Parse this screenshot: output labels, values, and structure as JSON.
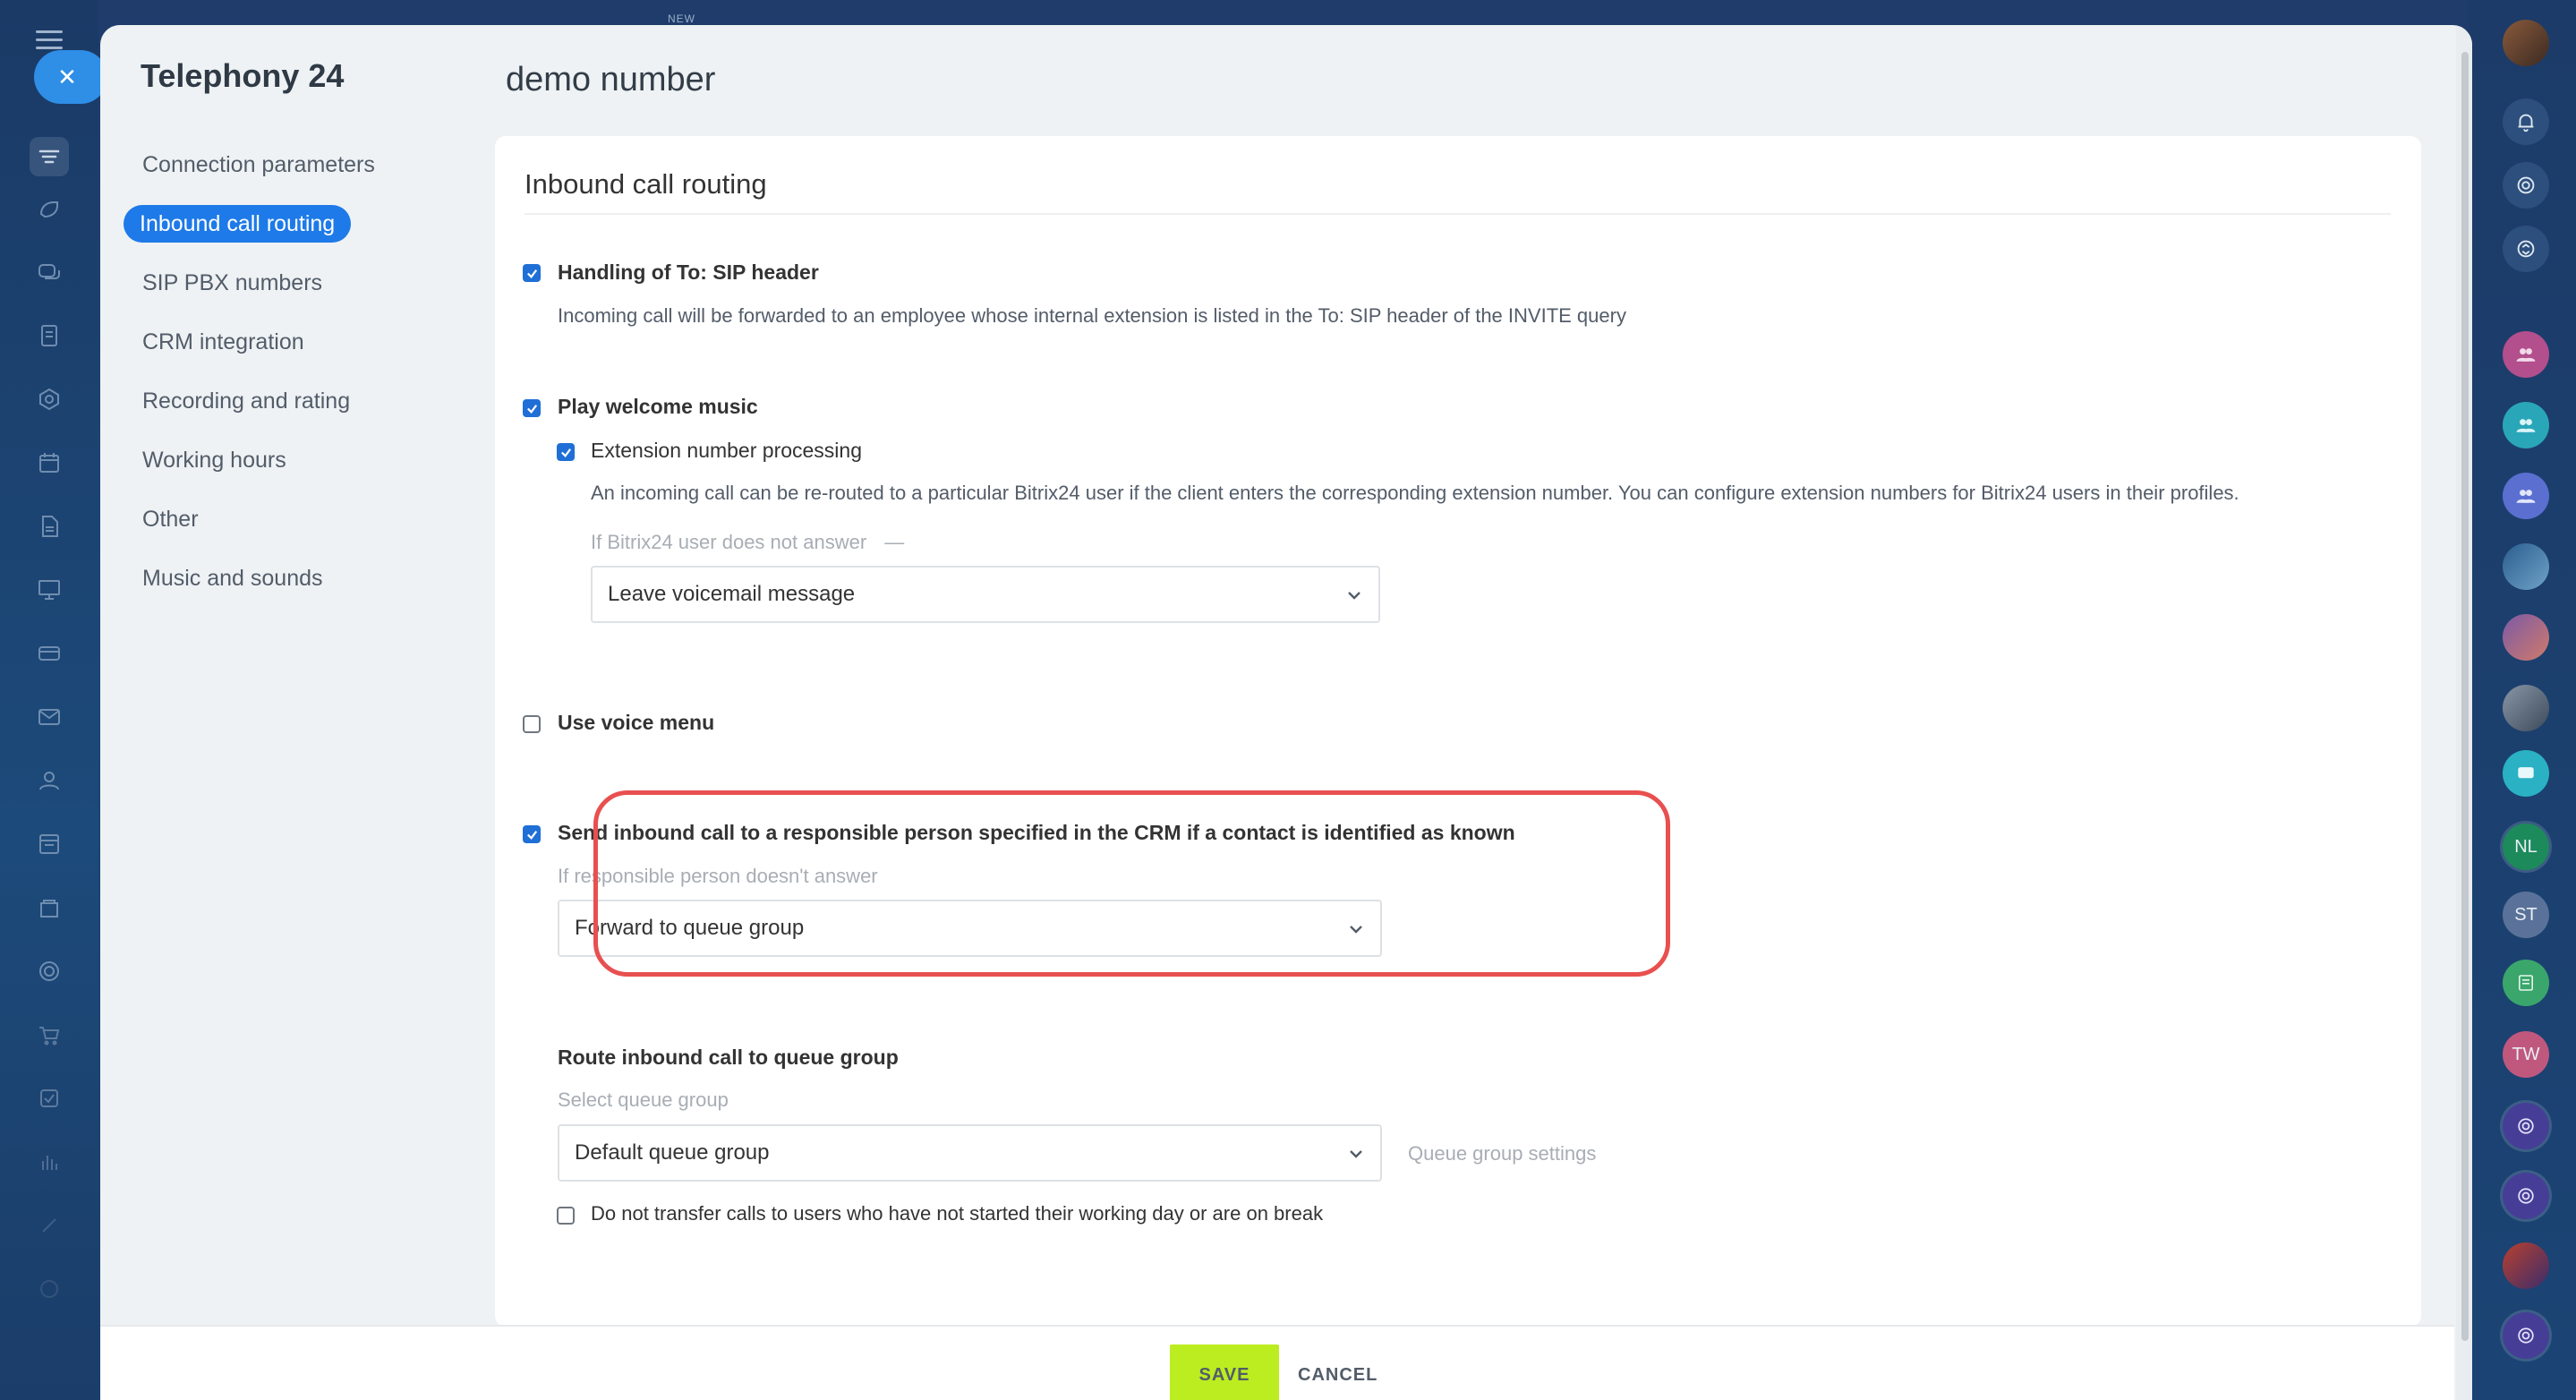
{
  "app": {
    "new_tag": "NEW"
  },
  "panel": {
    "title": "Telephony 24",
    "page_title": "demo number"
  },
  "menu": {
    "items": [
      {
        "label": "Connection parameters"
      },
      {
        "label": "Inbound call routing"
      },
      {
        "label": "SIP PBX numbers"
      },
      {
        "label": "CRM integration"
      },
      {
        "label": "Recording and rating"
      },
      {
        "label": "Working hours"
      },
      {
        "label": "Other"
      },
      {
        "label": "Music and sounds"
      }
    ],
    "active": "Inbound call routing"
  },
  "card": {
    "title": "Inbound call routing",
    "sip_header": {
      "label": "Handling of To: SIP header",
      "checked": true,
      "description": "Incoming call will be forwarded to an employee whose internal extension is listed in the To: SIP header of the INVITE query"
    },
    "welcome_music": {
      "label": "Play welcome music",
      "checked": true
    },
    "extension": {
      "label": "Extension number processing",
      "checked": true,
      "description": "An incoming call can be re-routed to a particular Bitrix24 user if the client enters the corresponding extension number. You can configure extension numbers for Bitrix24 users in their profiles.",
      "no_answer_hint": "If Bitrix24 user does not answer",
      "no_answer_dash": "—",
      "no_answer_value": "Leave voicemail message"
    },
    "voice_menu": {
      "label": "Use voice menu",
      "checked": false
    },
    "crm_responsible": {
      "label": "Send inbound call to a responsible person specified in the CRM if a contact is identified as known",
      "checked": true,
      "hint": "If responsible person doesn't answer",
      "value": "Forward to queue group"
    },
    "queue": {
      "heading": "Route inbound call to queue group",
      "hint": "Select queue group",
      "value": "Default queue group",
      "settings_link": "Queue group settings",
      "skip_label": "Do not transfer calls to users who have not started their working day or are on break",
      "skip_checked": false
    }
  },
  "footer": {
    "save_label": "SAVE",
    "cancel_label": "CANCEL"
  },
  "right_rail": {
    "initials": [
      "NL",
      "ST",
      "TW"
    ]
  },
  "colors": {
    "accent": "#1e7ae8",
    "save": "#bbed21",
    "highlight": "#e8504f"
  }
}
